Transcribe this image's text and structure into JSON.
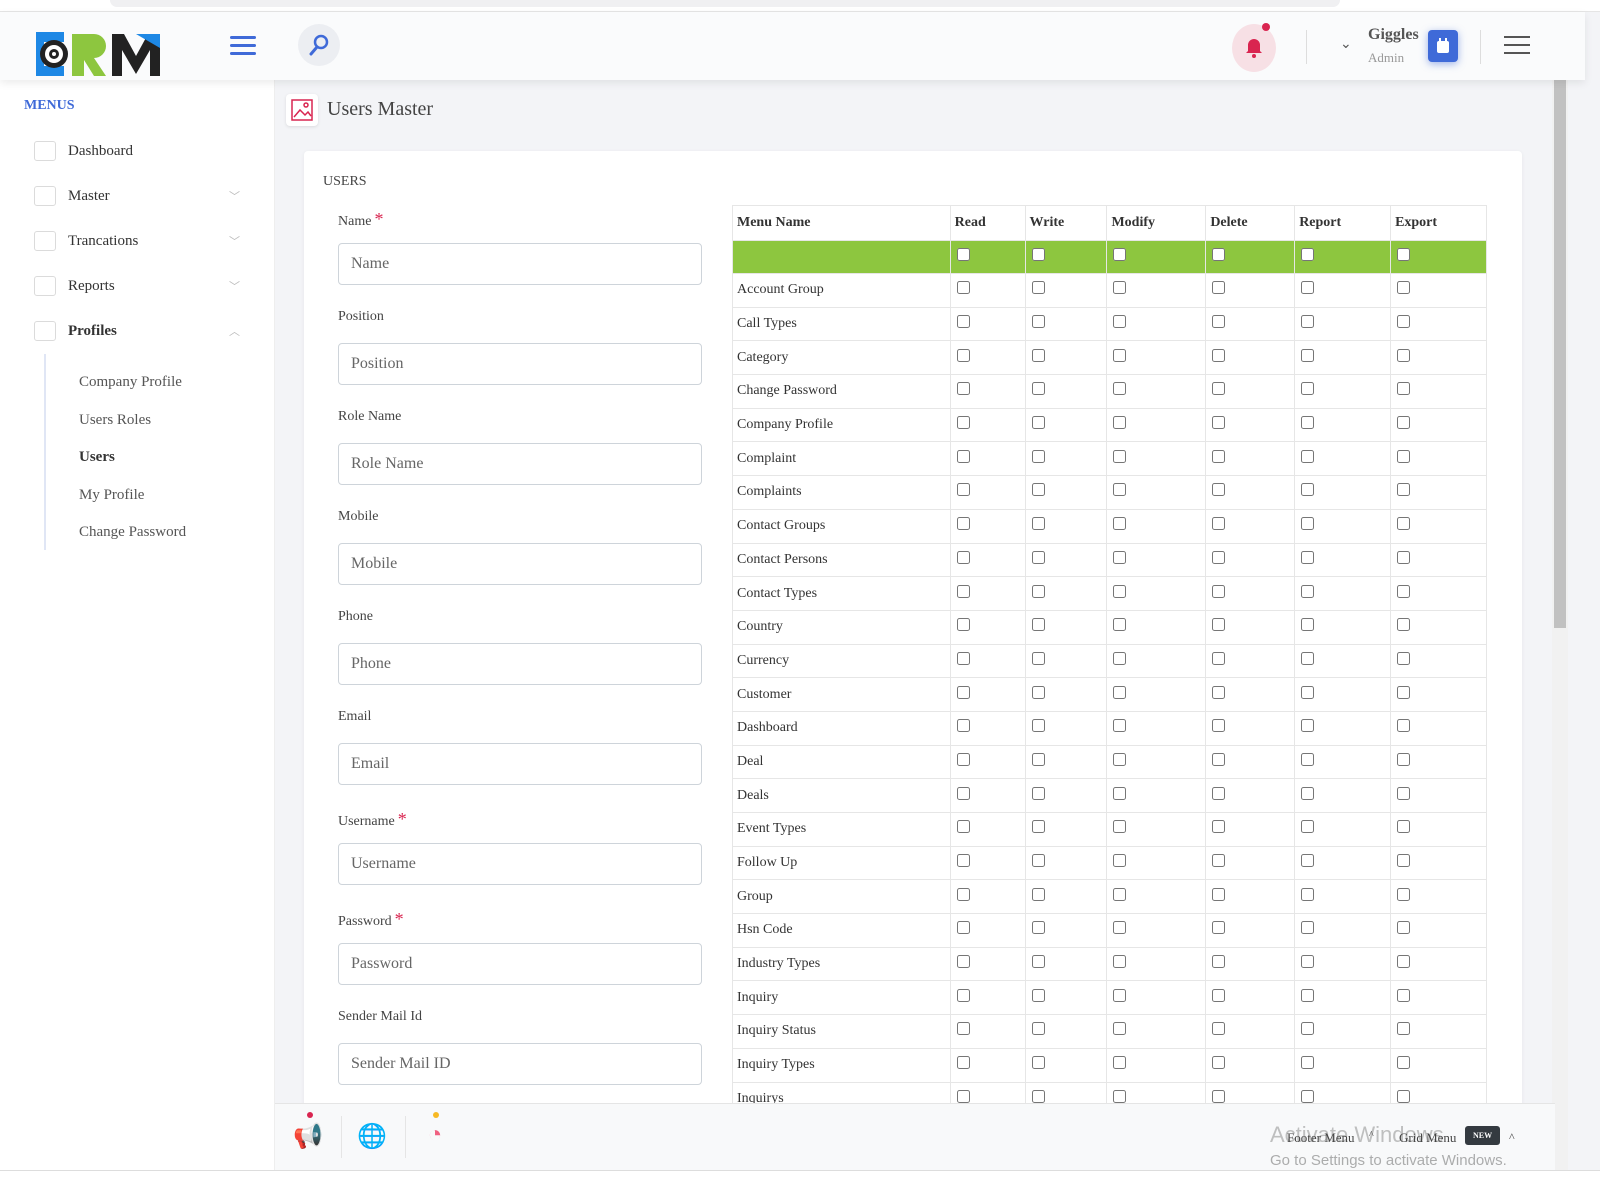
{
  "header": {
    "logo_text": "CRM",
    "user_name": "Giggles",
    "user_role": "Admin"
  },
  "sidebar": {
    "title": "MENUS",
    "items": [
      {
        "label": "Dashboard",
        "icon": "rocket-icon",
        "has_caret": false
      },
      {
        "label": "Master",
        "icon": "box-icon",
        "has_caret": true
      },
      {
        "label": "Trancations",
        "icon": "users-icon",
        "has_caret": true
      },
      {
        "label": "Reports",
        "icon": "card-icon",
        "has_caret": true
      },
      {
        "label": "Profiles",
        "icon": "calendar-icon",
        "has_caret": true,
        "expanded": true
      }
    ],
    "subitems": [
      {
        "label": "Company Profile"
      },
      {
        "label": "Users Roles"
      },
      {
        "label": "Users",
        "active": true
      },
      {
        "label": "My Profile"
      },
      {
        "label": "Change Password"
      }
    ]
  },
  "page": {
    "title": "Users Master",
    "card_title": "USERS"
  },
  "form": [
    {
      "label": "Name",
      "placeholder": "Name",
      "required": true
    },
    {
      "label": "Position",
      "placeholder": "Position"
    },
    {
      "label": "Role Name",
      "placeholder": "Role Name"
    },
    {
      "label": "Mobile",
      "placeholder": "Mobile"
    },
    {
      "label": "Phone",
      "placeholder": "Phone"
    },
    {
      "label": "Email",
      "placeholder": "Email"
    },
    {
      "label": "Username",
      "placeholder": "Username",
      "required": true
    },
    {
      "label": "Password",
      "placeholder": "Password",
      "required": true
    },
    {
      "label": "Sender Mail Id",
      "placeholder": "Sender Mail ID"
    }
  ],
  "table": {
    "columns": [
      "Menu Name",
      "Read",
      "Write",
      "Modify",
      "Delete",
      "Report",
      "Export"
    ],
    "rows": [
      "Account Group",
      "Call Types",
      "Category",
      "Change Password",
      "Company Profile",
      "Complaint",
      "Complaints",
      "Contact Groups",
      "Contact Persons",
      "Contact Types",
      "Country",
      "Currency",
      "Customer",
      "Dashboard",
      "Deal",
      "Deals",
      "Event Types",
      "Follow Up",
      "Group",
      "Hsn Code",
      "Industry Types",
      "Inquiry",
      "Inquiry Status",
      "Inquiry Types",
      "Inquirys"
    ]
  },
  "footer": {
    "footer_menu": "Footer Menu",
    "grid_menu": "Grid Menu",
    "badge": "NEW",
    "watermark_title": "Activate Windows",
    "watermark_sub": "Go to Settings to activate Windows."
  },
  "colors": {
    "accent": "#3f6ad8",
    "danger": "#d92550",
    "select_all_row": "#8dc63f"
  }
}
